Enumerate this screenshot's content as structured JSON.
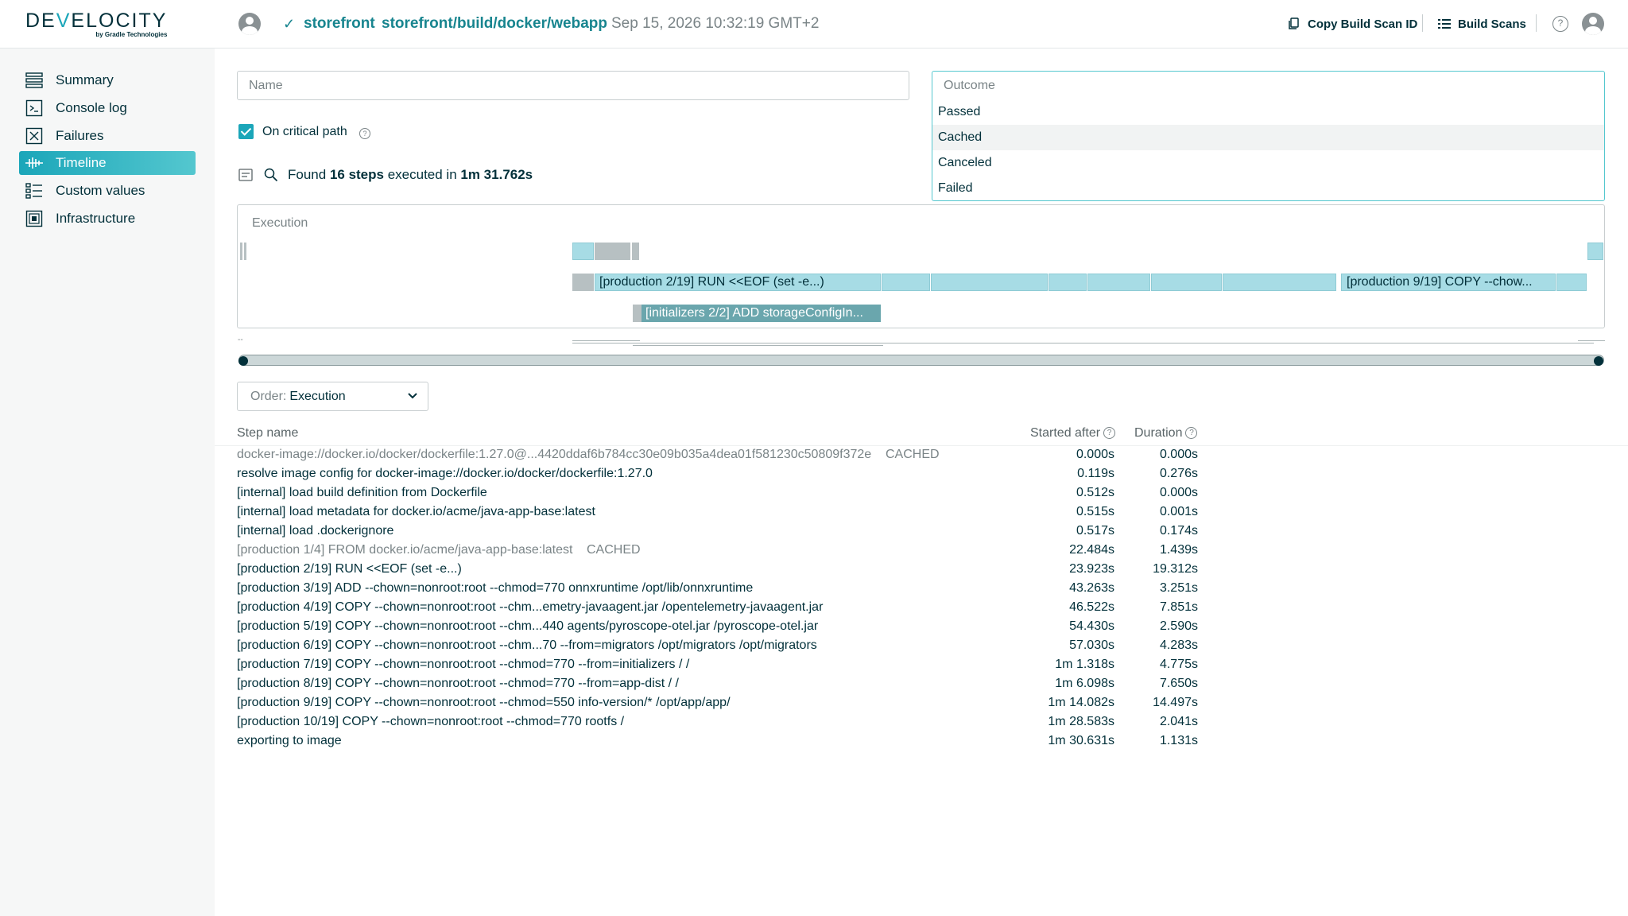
{
  "header": {
    "logo_prefix": "DE",
    "logo_highlight": "V",
    "logo_suffix": "ELOCITY",
    "logo_subtitle": "by Gradle Technologies",
    "project": "storefront",
    "build_path": "storefront/build/docker/webapp",
    "build_time": "Sep 15, 2026 10:32:19 GMT+2",
    "copy_id_label": "Copy Build Scan ID",
    "build_scans_label": "Build Scans",
    "help_label": "?"
  },
  "sidebar": {
    "items": [
      {
        "label": "Summary",
        "icon": "summary-icon"
      },
      {
        "label": "Console log",
        "icon": "console-icon"
      },
      {
        "label": "Failures",
        "icon": "failures-icon"
      },
      {
        "label": "Timeline",
        "icon": "timeline-icon",
        "active": true
      },
      {
        "label": "Custom values",
        "icon": "custom-values-icon"
      },
      {
        "label": "Infrastructure",
        "icon": "infrastructure-icon"
      }
    ]
  },
  "filters": {
    "name_placeholder": "Name",
    "critical_path_label": "On critical path",
    "outcome_placeholder": "Outcome",
    "outcome_options": [
      "Passed",
      "Cached",
      "Canceled",
      "Failed"
    ],
    "found_prefix": "Found ",
    "found_steps": "16 steps",
    "found_middle": " executed in ",
    "found_time": "1m 31.762s"
  },
  "timeline": {
    "label": "Execution",
    "bar_labels": [
      "[production 2/19] RUN <<EOF (set -e...)",
      "[production 9/19] COPY --chow...",
      "[initializers 2/2] ADD storageConfigIn..."
    ],
    "mini_marker": "--"
  },
  "order": {
    "label": "Order:",
    "value": "Execution"
  },
  "table": {
    "col_name": "Step name",
    "col_started": "Started after",
    "col_duration": "Duration",
    "rows": [
      {
        "name": "docker-image://docker.io/docker/dockerfile:1.27.0@...4420ddaf6b784cc30e09b035a4dea01f581230c50809f372e",
        "badge": "CACHED",
        "started": "0.000s",
        "duration": "0.000s"
      },
      {
        "name": "resolve image config for docker-image://docker.io/docker/dockerfile:1.27.0",
        "badge": "",
        "started": "0.119s",
        "duration": "0.276s"
      },
      {
        "name": "[internal] load build definition from Dockerfile",
        "badge": "",
        "started": "0.512s",
        "duration": "0.000s"
      },
      {
        "name": "[internal] load metadata for docker.io/acme/java-app-base:latest",
        "badge": "",
        "started": "0.515s",
        "duration": "0.001s"
      },
      {
        "name": "[internal] load .dockerignore",
        "badge": "",
        "started": "0.517s",
        "duration": "0.174s"
      },
      {
        "name": "[production 1/4] FROM docker.io/acme/java-app-base:latest",
        "badge": "CACHED",
        "started": "22.484s",
        "duration": "1.439s"
      },
      {
        "name": "[production 2/19] RUN <<EOF (set -e...)",
        "badge": "",
        "started": "23.923s",
        "duration": "19.312s"
      },
      {
        "name": "[production 3/19] ADD --chown=nonroot:root --chmod=770 onnxruntime /opt/lib/onnxruntime",
        "badge": "",
        "started": "43.263s",
        "duration": "3.251s"
      },
      {
        "name": "[production 4/19] COPY --chown=nonroot:root --chm...emetry-javaagent.jar /opentelemetry-javaagent.jar",
        "badge": "",
        "started": "46.522s",
        "duration": "7.851s"
      },
      {
        "name": "[production 5/19] COPY --chown=nonroot:root --chm...440 agents/pyroscope-otel.jar /pyroscope-otel.jar",
        "badge": "",
        "started": "54.430s",
        "duration": "2.590s"
      },
      {
        "name": "[production 6/19] COPY --chown=nonroot:root --chm...70 --from=migrators /opt/migrators /opt/migrators",
        "badge": "",
        "started": "57.030s",
        "duration": "4.283s"
      },
      {
        "name": "[production 7/19] COPY --chown=nonroot:root --chmod=770 --from=initializers / /",
        "badge": "",
        "started": "1m 1.318s",
        "duration": "4.775s"
      },
      {
        "name": "[production 8/19] COPY --chown=nonroot:root --chmod=770 --from=app-dist / /",
        "badge": "",
        "started": "1m 6.098s",
        "duration": "7.650s"
      },
      {
        "name": "[production 9/19] COPY --chown=nonroot:root --chmod=550 info-version/* /opt/app/app/",
        "badge": "",
        "started": "1m 14.082s",
        "duration": "14.497s"
      },
      {
        "name": "[production 10/19] COPY --chown=nonroot:root --chmod=770 rootfs /",
        "badge": "",
        "started": "1m 28.583s",
        "duration": "2.041s"
      },
      {
        "name": "exporting to image",
        "badge": "",
        "started": "1m 30.631s",
        "duration": "1.131s"
      }
    ]
  },
  "colors": {
    "accent": "#1ba6b9",
    "bar_light": "#a7dce5",
    "bar_cached": "#b7c0c2",
    "bar_dark": "#6aa6ad",
    "text": "#02303a",
    "muted": "#7a8487"
  }
}
